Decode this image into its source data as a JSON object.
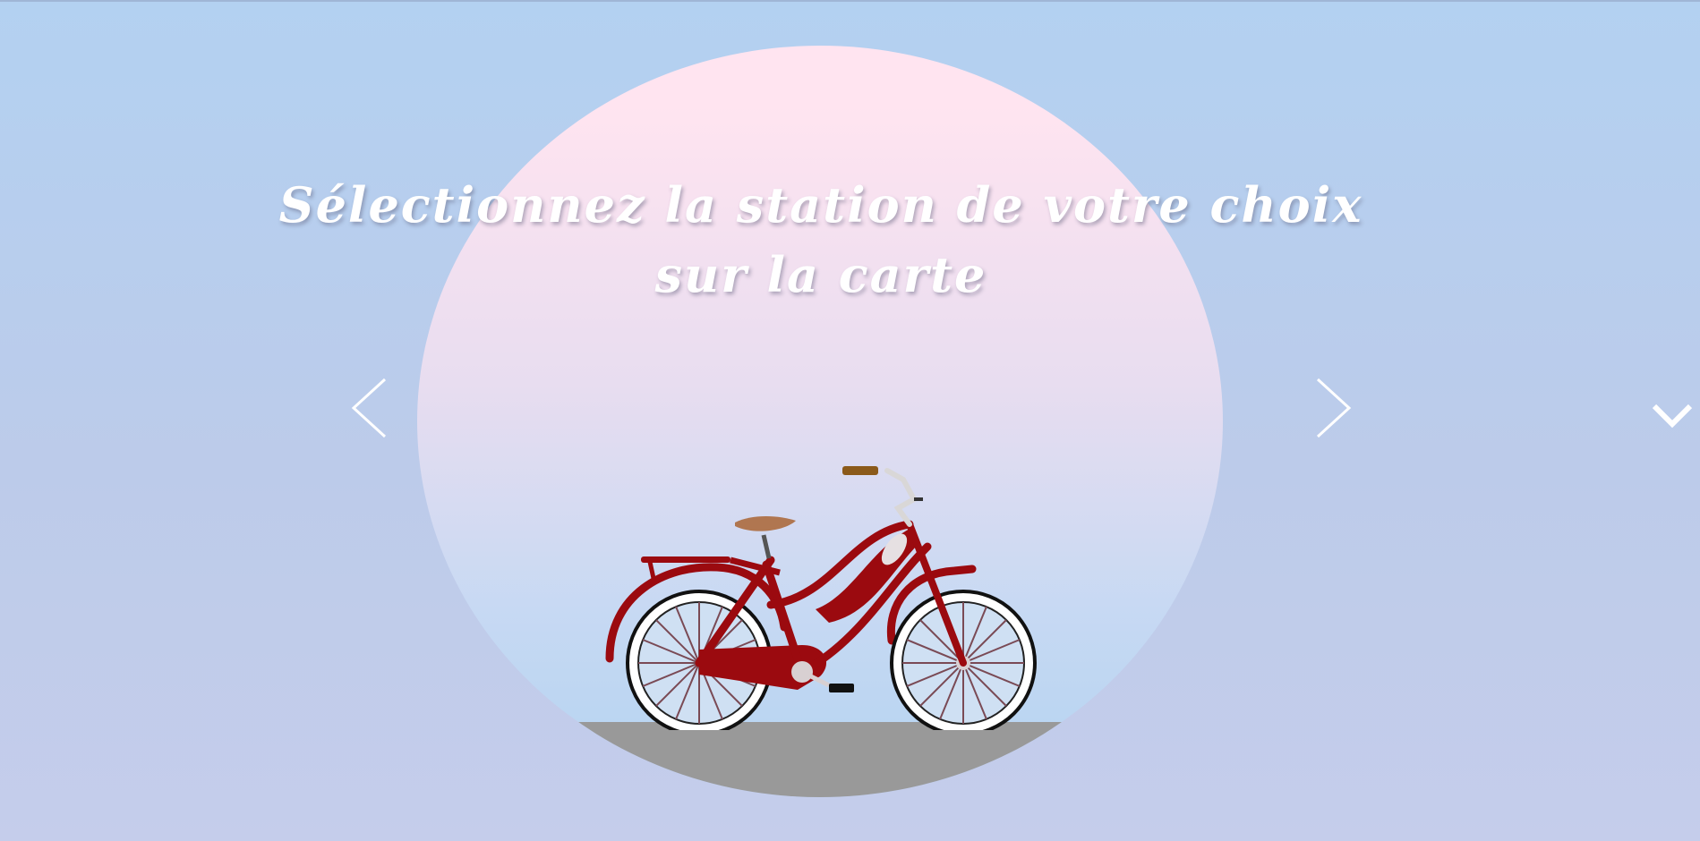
{
  "hero": {
    "title_line1": "Sélectionnez la station de votre choix",
    "title_line2": "sur la carte"
  },
  "controls": {
    "prev_icon": "chevron-left-icon",
    "next_icon": "chevron-right-icon",
    "scroll_down_icon": "chevron-down-icon"
  },
  "colors": {
    "sky_top": "#b3d1f1",
    "sky_bottom": "#c5cdeb",
    "circle_top": "#ffe4f0",
    "circle_bottom": "#b3d3f1",
    "ground": "#999999",
    "bike_frame": "#9b0a0f",
    "icon": "#ffffff"
  }
}
